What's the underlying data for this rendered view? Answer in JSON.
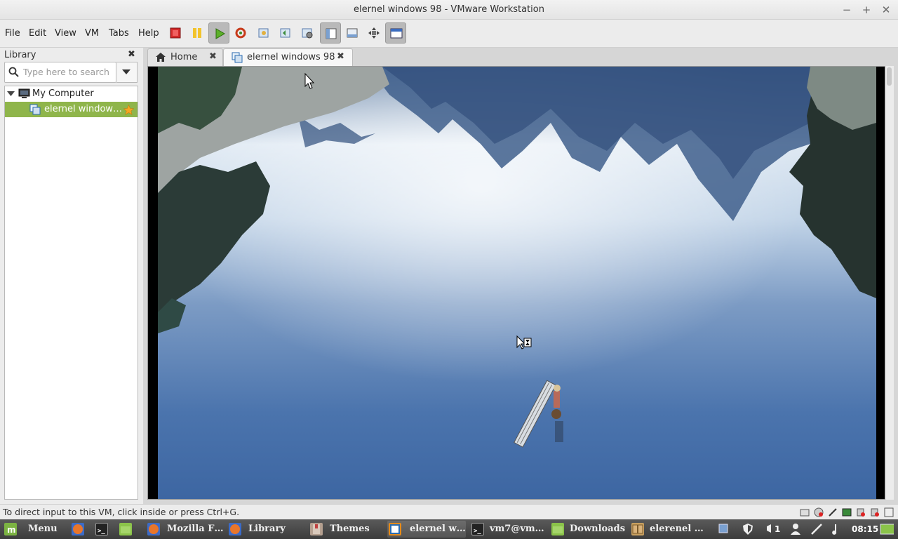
{
  "window": {
    "title": "elernel windows 98 - VMware Workstation",
    "minimize": "−",
    "maximize": "+",
    "close": "✕"
  },
  "menu": [
    "File",
    "Edit",
    "View",
    "VM",
    "Tabs",
    "Help"
  ],
  "library": {
    "title": "Library",
    "close": "✖",
    "search_placeholder": "Type here to search",
    "tree": {
      "root_label": "My Computer",
      "vm_label": "elernel window…"
    }
  },
  "tabs": [
    {
      "label": "Home",
      "close": "✖"
    },
    {
      "label": "elernel windows 98",
      "close": "✖"
    }
  ],
  "status": {
    "text": "To direct input to this VM, click inside or press Ctrl+G."
  },
  "taskbar": {
    "menu_label": "Menu",
    "tasks": [
      "Mozilla F…",
      "Library",
      "Themes",
      "elernel w…",
      "vm7@vm…",
      "Downloads",
      "elerenel …"
    ],
    "notification_count": "1",
    "clock": "08:15"
  },
  "colors": {
    "selection": "#8fb54b",
    "taskbar": "#444444",
    "vm_background": "#000000"
  }
}
